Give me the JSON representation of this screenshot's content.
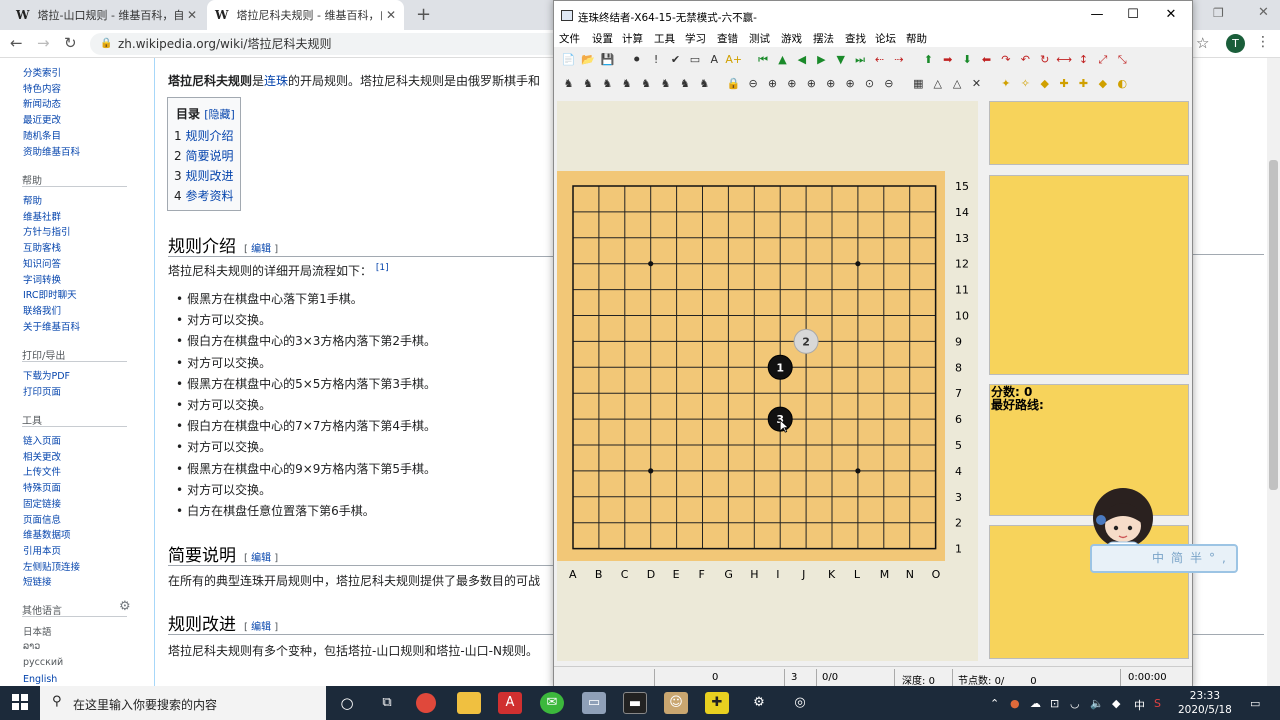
{
  "browser": {
    "tabs": [
      {
        "icon": "W",
        "title": "塔拉-山口规则 - 维基百科，自由的百科全书",
        "close": "✕"
      },
      {
        "icon": "W",
        "title": "塔拉尼科夫规则 - 维基百科，自由的百科全书",
        "close": "✕"
      }
    ],
    "new_tab": "+",
    "url": "zh.wikipedia.org/wiki/塔拉尼科夫规则",
    "avatar_letter": "T"
  },
  "wiki": {
    "sidebar": {
      "top_links": [
        "分类索引",
        "特色内容",
        "新闻动态",
        "最近更改",
        "随机条目",
        "资助维基百科"
      ],
      "help_heading": "帮助",
      "help_links": [
        "帮助",
        "维基社群",
        "方针与指引",
        "互助客栈",
        "知识问答",
        "字词转换",
        "IRC即时聊天",
        "联络我们",
        "关于维基百科"
      ],
      "print_heading": "打印/导出",
      "print_links": [
        "下载为PDF",
        "打印页面"
      ],
      "tools_heading": "工具",
      "tools_links": [
        "链入页面",
        "相关更改",
        "上传文件",
        "特殊页面",
        "固定链接",
        "页面信息",
        "维基数据项",
        "引用本页",
        "左侧贴顶连接",
        "短链接"
      ],
      "lang_heading": "其他语言",
      "lang_links": [
        "日本語",
        "ລາວ",
        "русский",
        "English"
      ]
    },
    "intro_bold": "塔拉尼科夫规则",
    "intro_mid": "是",
    "intro_link": "连珠",
    "intro_rest": "的开局规则。塔拉尼科夫规则是由俄罗斯棋手和",
    "toc": {
      "title": "目录",
      "toggle": "[隐藏]",
      "items": [
        {
          "num": "1",
          "text": "规则介绍"
        },
        {
          "num": "2",
          "text": "简要说明"
        },
        {
          "num": "3",
          "text": "规则改进"
        },
        {
          "num": "4",
          "text": "参考资料"
        }
      ]
    },
    "edit_label": "编辑",
    "section1_title": "规则介绍",
    "section1_lead": "塔拉尼科夫规则的详细开局流程如下：",
    "section1_ref": "[1]",
    "steps": [
      "假黑方在棋盘中心落下第1手棋。",
      "对方可以交换。",
      "假白方在棋盘中心的3×3方格内落下第2手棋。",
      "对方可以交换。",
      "假黑方在棋盘中心的5×5方格内落下第3手棋。",
      "对方可以交换。",
      "假白方在棋盘中心的7×7方格内落下第4手棋。",
      "对方可以交换。",
      "假黑方在棋盘中心的9×9方格内落下第5手棋。",
      "对方可以交换。",
      "白方在棋盘任意位置落下第6手棋。"
    ],
    "section2_title": "简要说明",
    "section2_text": "在所有的典型连珠开局规则中，塔拉尼科夫规则提供了最多数目的可战",
    "section3_title": "规则改进",
    "section3_text": "塔拉尼科夫规则有多个变种，包括塔拉-山口规则和塔拉-山口-N规则。"
  },
  "app": {
    "title": "连珠终结者-X64-15-无禁模式-六不赢-",
    "window_buttons": {
      "minimize": "—",
      "maximize": "☐",
      "close": "✕"
    },
    "menu": [
      "文件",
      "设置",
      "计算",
      "工具",
      "学习",
      "查错",
      "测试",
      "游戏",
      "摆法",
      "查找",
      "论坛",
      "帮助"
    ],
    "board": {
      "rows": [
        "15",
        "14",
        "13",
        "12",
        "11",
        "10",
        "9",
        "8",
        "7",
        "6",
        "5",
        "4",
        "3",
        "2",
        "1"
      ],
      "cols": [
        "A",
        "B",
        "C",
        "D",
        "E",
        "F",
        "G",
        "H",
        "I",
        "J",
        "K",
        "L",
        "M",
        "N",
        "O"
      ],
      "stones": [
        {
          "n": "1",
          "color": "black",
          "col": 8,
          "row": 8
        },
        {
          "n": "2",
          "color": "white",
          "col": 9,
          "row": 9
        },
        {
          "n": "3",
          "color": "black",
          "col": 8,
          "row": 6
        }
      ]
    },
    "score_label": "分数:",
    "score_value": "0",
    "best_line_label": "最好路线:",
    "status": {
      "a": "0",
      "b": "3",
      "c": "0/0",
      "depth_label": "深度:",
      "depth_value": "0",
      "nodes_label": "节点数:",
      "nodes_value": "0/",
      "nodes_extra": "0",
      "time": "0:00:00"
    }
  },
  "ime": {
    "text": "中简半°,"
  },
  "taskbar": {
    "search_placeholder": "在这里输入你要搜索的内容",
    "time": "23:33",
    "date": "2020/5/18",
    "ime_lang": "中"
  }
}
